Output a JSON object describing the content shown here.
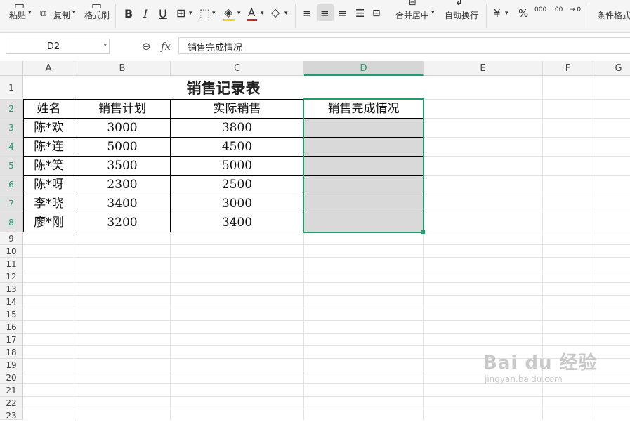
{
  "toolbar": {
    "paste_label": "粘贴",
    "copy_label": "复制",
    "format_painter_label": "格式刷",
    "bold": "B",
    "italic": "I",
    "underline": "U",
    "font_color_glyph": "A",
    "merge_center_label": "合并居中",
    "wrap_text_label": "自动换行",
    "currency_glyph": "¥",
    "percent_glyph": "%",
    "thousands_glyph": "000",
    "decimal_inc_glyph": ".00",
    "decimal_dec_glyph": "→.0",
    "conditional_format_label": "条件格式"
  },
  "formula_bar": {
    "name_box": "D2",
    "fx_label": "fx",
    "content": "销售完成情况"
  },
  "columns": [
    "A",
    "B",
    "C",
    "D",
    "E",
    "F",
    "G"
  ],
  "rows": [
    "1",
    "2",
    "3",
    "4",
    "5",
    "6",
    "7",
    "8",
    "9",
    "10",
    "11",
    "12",
    "13",
    "14",
    "15",
    "16",
    "17",
    "18",
    "19",
    "20",
    "21",
    "22",
    "23"
  ],
  "sheet": {
    "title": "销售记录表",
    "headers": [
      "姓名",
      "销售计划",
      "实际销售",
      "销售完成情况"
    ],
    "records": [
      {
        "name": "陈*欢",
        "plan": "3000",
        "actual": "3800"
      },
      {
        "name": "陈*连",
        "plan": "5000",
        "actual": "4500"
      },
      {
        "name": "陈*笑",
        "plan": "3500",
        "actual": "5000"
      },
      {
        "name": "陈*呀",
        "plan": "2300",
        "actual": "2500"
      },
      {
        "name": "李*晓",
        "plan": "3400",
        "actual": "3000"
      },
      {
        "name": "廖*刚",
        "plan": "3200",
        "actual": "3400"
      }
    ]
  },
  "selection": {
    "active_cell": "D2",
    "range": "D2:D8"
  },
  "colors": {
    "accent": "#1e9f6a",
    "selected_fill": "#d9d9d9"
  },
  "watermark": {
    "brand": "Bai du 经验",
    "url": "jingyan.baidu.com"
  }
}
